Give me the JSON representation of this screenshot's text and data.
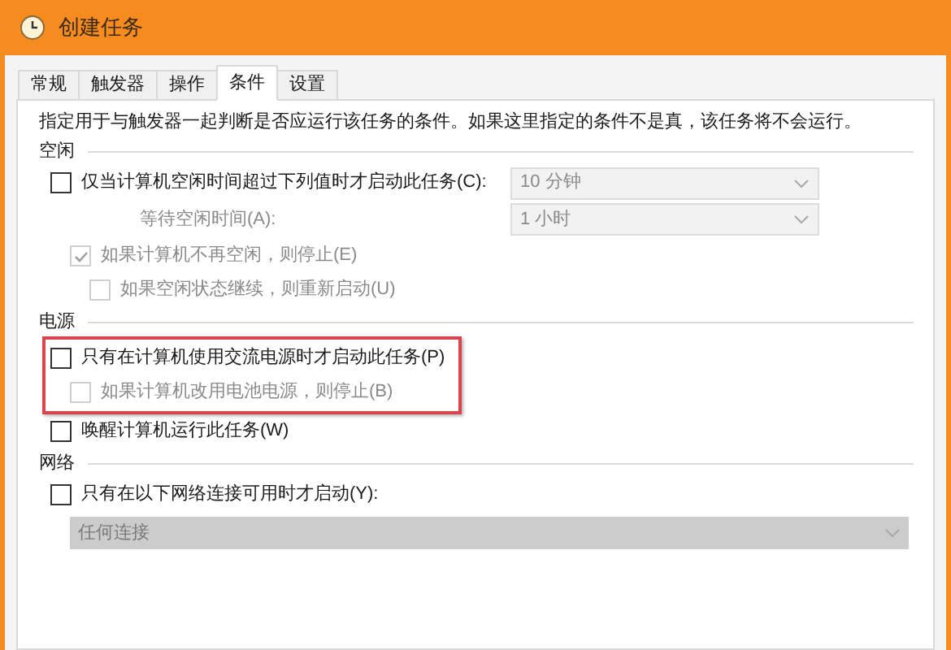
{
  "window": {
    "title": "创建任务"
  },
  "tabs": [
    {
      "label": "常规",
      "selected": false
    },
    {
      "label": "触发器",
      "selected": false
    },
    {
      "label": "操作",
      "selected": false
    },
    {
      "label": "条件",
      "selected": true
    },
    {
      "label": "设置",
      "selected": false
    }
  ],
  "description": "指定用于与触发器一起判断是否应运行该任务的条件。如果这里指定的条件不是真，该任务将不会运行。",
  "sections": [
    {
      "title": "空闲",
      "items": [
        {
          "kind": "checkbox",
          "label": "仅当计算机空闲时间超过下列值时才启动此任务(C):",
          "checked": false,
          "disabled": false,
          "highlighted": false,
          "dropdown": {
            "value": "10 分钟",
            "disabled": true
          },
          "children": [
            {
              "kind": "field",
              "label": "等待空闲时间(A):",
              "disabled": true,
              "dropdown": {
                "value": "1 小时",
                "disabled": true
              }
            },
            {
              "kind": "checkbox",
              "label": "如果计算机不再空闲，则停止(E)",
              "checked": true,
              "disabled": true,
              "children": [
                {
                  "kind": "checkbox",
                  "label": "如果空闲状态继续，则重新启动(U)",
                  "checked": false,
                  "disabled": true
                }
              ]
            }
          ]
        }
      ]
    },
    {
      "title": "电源",
      "items": [
        {
          "kind": "checkbox",
          "label": "只有在计算机使用交流电源时才启动此任务(P)",
          "checked": false,
          "disabled": false,
          "highlighted": true,
          "children": [
            {
              "kind": "checkbox",
              "label": "如果计算机改用电池电源，则停止(B)",
              "checked": false,
              "disabled": true
            }
          ]
        },
        {
          "kind": "checkbox",
          "label": "唤醒计算机运行此任务(W)",
          "checked": false,
          "disabled": false,
          "highlighted": false
        }
      ]
    },
    {
      "title": "网络",
      "items": [
        {
          "kind": "checkbox",
          "label": "只有在以下网络连接可用时才启动(Y):",
          "checked": false,
          "disabled": false,
          "highlighted": false
        },
        {
          "kind": "wide-dropdown",
          "value": "任何连接",
          "disabled": true,
          "highlighted": false
        }
      ]
    }
  ]
}
